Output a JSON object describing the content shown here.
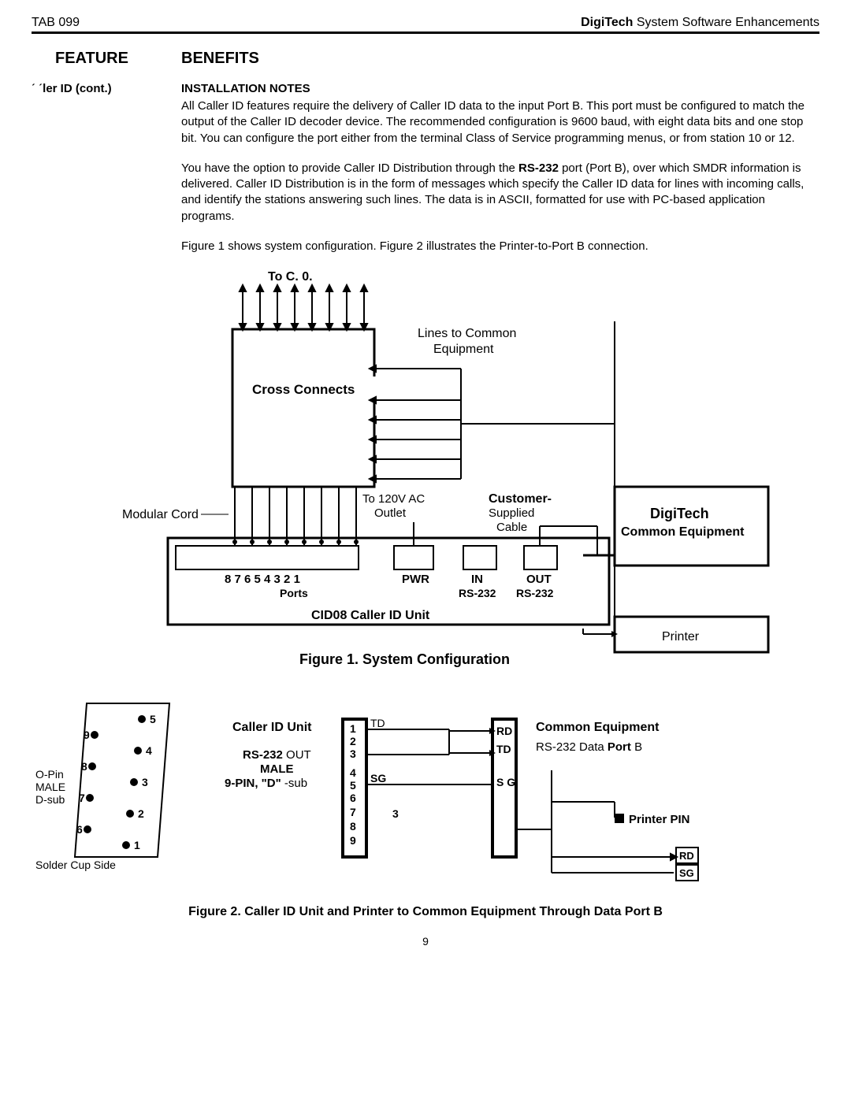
{
  "header": {
    "left": "TAB 099",
    "rightBold": "DigiTech",
    "rightRest": "  System  Software  Enhancements"
  },
  "headings": {
    "feature": "FEATURE",
    "benefits": "BENEFITS",
    "sideLabel": "ˊ  ˊler ID (cont.)",
    "install": "INSTALLATION NOTES"
  },
  "para1": "All Caller ID features require the delivery of Caller ID data to the input Port B. This port must be configured to match the output of the Caller ID decoder device. The recommended configuration is 9600 baud, with eight data bits and one stop bit. You can configure the port either from the terminal Class of Service programming menus, or from station 10 or 12.",
  "para2a": "You have the option to provide Caller ID Distribution through the    ",
  "para2bold": "RS-232",
  "para2b": " port (Port B), over which SMDR information is delivered. Caller ID Distribution is in the form of messages which specify the Caller ID data for lines with incoming calls, and identify the stations answering such lines. The data is in ASCII, formatted for use with PC-based application programs.",
  "para3": "Figure 1 shows system configuration. Figure 2 illustrates the Printer-to-Port B connection.",
  "fig1": {
    "toCO": "To C. 0.",
    "cross": "Cross Connects",
    "lines1": "Lines to Common",
    "lines2": "Equipment",
    "modular": "Modular Cord",
    "ac1": "To 120V AC",
    "ac2": "Outlet",
    "cust1": "Customer-",
    "cust2": "Supplied",
    "cust3": "Cable",
    "digi1": "DigiTech",
    "digi2": "Common Equipment",
    "portnums": "8  7  6  5  4  3  2  1",
    "portslbl": "Ports",
    "pwr": "PWR",
    "in": "IN",
    "out": "OUT",
    "rsin": "RS-232",
    "rsout": "RS-232",
    "unit": "CID08 Caller ID Unit",
    "printer": "Printer",
    "caption": "Figure 1. System Configuration"
  },
  "fig2": {
    "pinSide1": "O-Pin",
    "pinSide2": "MALE",
    "pinSide3": "D-sub",
    "solder": "Solder Cup Side",
    "p1": "1",
    "p2": "2",
    "p3": "3",
    "p4": "4",
    "p5": "5",
    "p6": "6",
    "p7": "7",
    "p8": "8",
    "p9": "9",
    "cidUnit": "Caller ID Unit",
    "rsout1": "RS-232",
    "rsout2": "OUT",
    "male": "MALE",
    "dsub1": "9-PIN, \"D\"",
    "dsub2": "-sub",
    "n1": "1",
    "n2": "2",
    "n3": "3",
    "n4": "4",
    "n5": "5",
    "n6": "6",
    "n7": "7",
    "n8": "8",
    "n9": "9",
    "td": "TD",
    "rd": "RD",
    "td2": "TD",
    "sg": "SG",
    "sg2": "S G",
    "three": "3",
    "common": "Common Equipment",
    "rsdata1": "RS-232  Data",
    "rsdata2": "Port",
    "rsdata3": "B",
    "printerPin": "Printer PIN",
    "rd2": "RD",
    "sg3": "SG",
    "caption": "Figure 2. Caller ID Unit and Printer to Common Equipment Through Data Port B"
  },
  "pagenum": "9"
}
